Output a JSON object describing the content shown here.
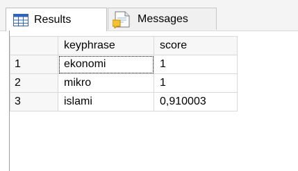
{
  "tabs": [
    {
      "label": "Results",
      "active": true,
      "icon": "grid-icon"
    },
    {
      "label": "Messages",
      "active": false,
      "icon": "messages-icon"
    }
  ],
  "results": {
    "columns": [
      "",
      "keyphrase",
      "score"
    ],
    "rows": [
      {
        "num": "1",
        "keyphrase": "ekonomi",
        "score": "1"
      },
      {
        "num": "2",
        "keyphrase": "mikro",
        "score": "1"
      },
      {
        "num": "3",
        "keyphrase": "islami",
        "score": "0,910003"
      }
    ],
    "selected_cell": "row 1 keyphrase"
  },
  "colors": {
    "tab_strip": "#f4f4f4",
    "grid_header": "#f7f7f7",
    "grid_line": "#d8d8d8",
    "icon_blue": "#2f63b8"
  }
}
